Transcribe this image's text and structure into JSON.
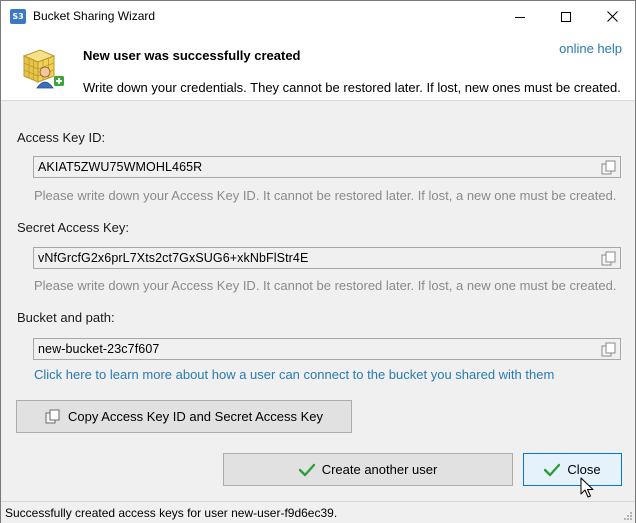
{
  "window": {
    "title": "Bucket Sharing Wizard",
    "app_icon_text": "S3"
  },
  "header": {
    "title": "New user was successfully created",
    "subtitle": "Write down your credentials. They cannot be restored later. If lost, new ones must be created.",
    "help_link": "online help"
  },
  "fields": {
    "access_key": {
      "label": "Access Key ID:",
      "value": "AKIAT5ZWU75WMOHL465R",
      "hint": "Please write down your Access Key ID. It cannot be restored later. If lost, a new one must be created."
    },
    "secret_key": {
      "label": "Secret Access Key:",
      "value": "vNfGrcfG2x6prL7Xts2ct7GxSUG6+xkNbFlStr4E",
      "hint": "Please write down your Access Key ID. It cannot be restored later. If lost, a new one must be created."
    },
    "bucket": {
      "label": "Bucket and path:",
      "value": "new-bucket-23c7f607"
    }
  },
  "learn_more_link": "Click here to learn more about how a user can connect to the bucket you shared with them",
  "buttons": {
    "copy_both": "Copy Access Key ID and Secret Access Key",
    "create_another": "Create another user",
    "close": "Close"
  },
  "status": {
    "text": "Successfully created access keys for user new-user-f9d6ec39."
  },
  "colors": {
    "link": "#2a7ab0",
    "hint": "#8a8a8a",
    "primary_border": "#0078d7",
    "check": "#2e9e3a"
  },
  "icons": {
    "app": "s3-app-icon",
    "header": "user-grid-add-icon",
    "copy": "copy-icon",
    "check": "check-icon"
  }
}
